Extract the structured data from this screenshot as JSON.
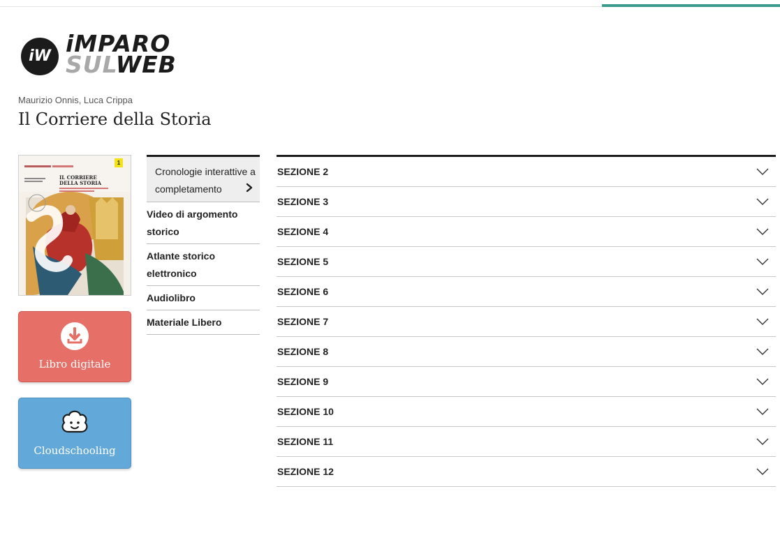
{
  "brand": {
    "logo_circle": "iW",
    "logo_top": "iMPARO",
    "logo_sul": "SUL",
    "logo_web": "WEB"
  },
  "book": {
    "authors": "Maurizio Onnis, Luca Crippa",
    "title": "Il Corriere della Storia",
    "cover": {
      "title_line1": "IL CORRIERE",
      "title_line2": "DELLA STORIA",
      "volume": "1"
    }
  },
  "actions": {
    "digital_book": "Libro digitale",
    "cloudschooling": "Cloudschooling"
  },
  "sidemenu": {
    "active": {
      "line1": "Cronologie interattive a",
      "line2": "completamento"
    },
    "items": [
      {
        "line1": "Video di argomento",
        "line2": "storico"
      },
      {
        "line1": "Atlante storico",
        "line2": "elettronico"
      },
      {
        "line1": "Audiolibro"
      },
      {
        "line1": "Materiale Libero"
      }
    ]
  },
  "sections": [
    "SEZIONE 2",
    "SEZIONE 3",
    "SEZIONE 4",
    "SEZIONE 5",
    "SEZIONE 6",
    "SEZIONE 7",
    "SEZIONE 8",
    "SEZIONE 9",
    "SEZIONE 10",
    "SEZIONE 11",
    "SEZIONE 12"
  ],
  "colors": {
    "accent": "#3a9a8c",
    "digital_button": "#e66f67",
    "cloud_button": "#62a9d9"
  }
}
